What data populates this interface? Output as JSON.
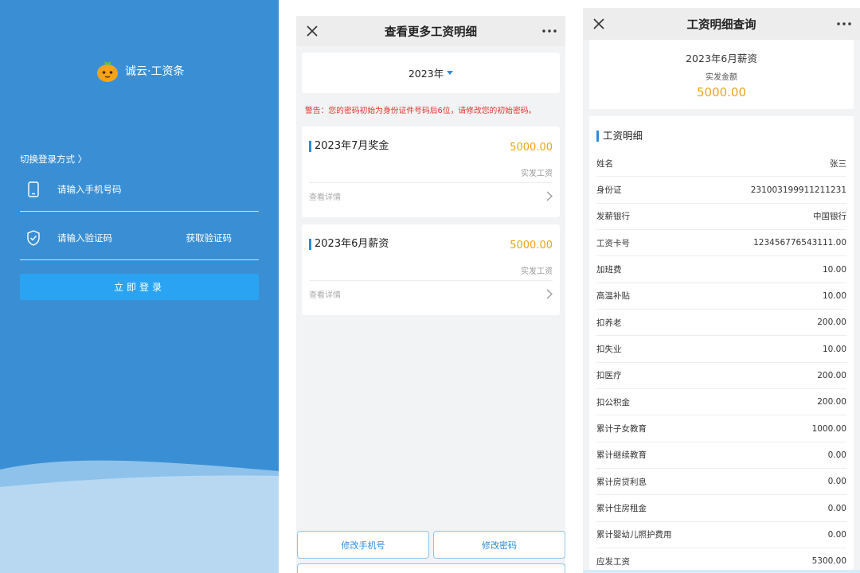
{
  "login": {
    "brand": "诚云·工资条",
    "switch_method": "切换登录方式 〉",
    "phone_placeholder": "请输入手机号码",
    "code_placeholder": "请输入验证码",
    "get_code": "获取验证码",
    "submit": "立即登录",
    "bg_color": "#3a8fd4",
    "button_color": "#2aa3f2"
  },
  "list": {
    "title": "查看更多工资明细",
    "year": "2023年",
    "warning": "警告：您的密码初始为身份证件号码后6位，请修改您的初始密码。",
    "cards": [
      {
        "title": "2023年7月奖金",
        "amount": "5000.00",
        "type": "实发工资",
        "detail": "查看详情"
      },
      {
        "title": "2023年6月薪资",
        "amount": "5000.00",
        "type": "实发工资",
        "detail": "查看详情"
      }
    ],
    "btn_phone": "修改手机号",
    "btn_password": "修改密码"
  },
  "detail": {
    "title": "工资明细查询",
    "month": "2023年6月薪资",
    "paid_label": "实发金额",
    "paid_amount": "5000.00",
    "section": "工资明细",
    "rows": [
      {
        "label": "姓名",
        "value": "张三"
      },
      {
        "label": "身份证",
        "value": "231003199911211231"
      },
      {
        "label": "发薪银行",
        "value": "中国银行"
      },
      {
        "label": "工资卡号",
        "value": "123456776543111.00"
      },
      {
        "label": "加班费",
        "value": "10.00"
      },
      {
        "label": "高温补贴",
        "value": "10.00"
      },
      {
        "label": "扣养老",
        "value": "200.00"
      },
      {
        "label": "扣失业",
        "value": "10.00"
      },
      {
        "label": "扣医疗",
        "value": "200.00"
      },
      {
        "label": "扣公积金",
        "value": "200.00"
      },
      {
        "label": "累计子女教育",
        "value": "1000.00"
      },
      {
        "label": "累计继续教育",
        "value": "0.00"
      },
      {
        "label": "累计房贷利息",
        "value": "0.00"
      },
      {
        "label": "累计住房租金",
        "value": "0.00"
      },
      {
        "label": "累计婴幼儿照护费用",
        "value": "0.00"
      },
      {
        "label": "应发工资",
        "value": "5300.00"
      }
    ]
  },
  "colors": {
    "accent_blue": "#2a8be0",
    "amount_orange": "#eaa51a",
    "warning_red": "#e0312a"
  },
  "icons": {
    "close": "close-icon",
    "more": "more-icon",
    "phone": "phone-icon",
    "shield": "shield-check-icon",
    "chevron": "chevron-right-icon",
    "logo": "orange-mascot-logo"
  }
}
